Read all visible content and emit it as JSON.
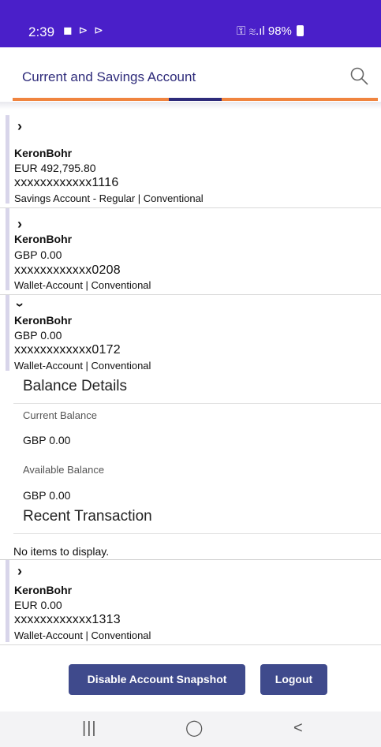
{
  "status_bar": {
    "time": "2:39",
    "left_icons": "◼ ⊳ ⊳",
    "right_status": "⚿ ≋.ıl 98%",
    "battery_percent": "98%"
  },
  "header": {
    "title": "Current and Savings Account",
    "search_icon": "search-icon"
  },
  "accounts": [
    {
      "name": "KeronBohr",
      "balance": "EUR 492,795.80",
      "number": "xxxxxxxxxxxx1116",
      "type": "Savings Account - Regular | Conventional",
      "expanded": false
    },
    {
      "name": "KeronBohr",
      "balance": "GBP 0.00",
      "number": "xxxxxxxxxxxx0208",
      "type": "Wallet-Account | Conventional",
      "expanded": false
    },
    {
      "name": "KeronBohr",
      "balance": "GBP 0.00",
      "number": "xxxxxxxxxxxx0172",
      "type": "Wallet-Account | Conventional",
      "expanded": true
    },
    {
      "name": "KeronBohr",
      "balance": "EUR 0.00",
      "number": "xxxxxxxxxxxx1313",
      "type": "Wallet-Account | Conventional",
      "expanded": false
    }
  ],
  "details": {
    "balance_title": "Balance Details",
    "current_label": "Current Balance",
    "current_value": "GBP 0.00",
    "available_label": "Available Balance",
    "available_value": "GBP 0.00",
    "recent_title": "Recent Transaction",
    "empty_message": "No items to display."
  },
  "buttons": {
    "disable_snapshot": "Disable Account Snapshot",
    "logout": "Logout"
  },
  "nav": {
    "recents": "|||",
    "home": "◯",
    "back": "<"
  },
  "colors": {
    "status_bar": "#4a1fc9",
    "title": "#2e2b7a",
    "accent_tab": "#f0843f",
    "button": "#3f4a8c"
  }
}
